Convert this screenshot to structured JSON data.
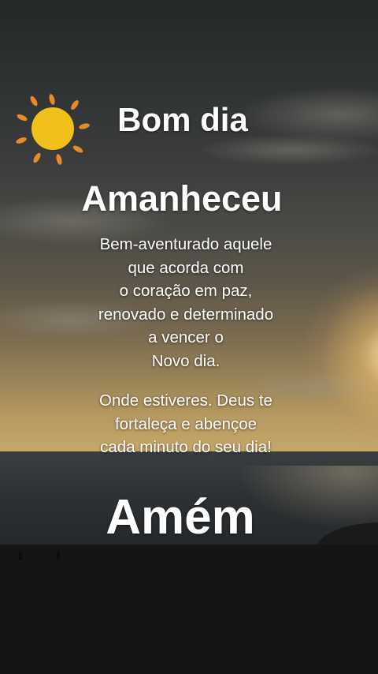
{
  "greeting": "Bom dia",
  "title": "Amanheceu",
  "verse_1": [
    "Bem-aventurado aquele",
    "que acorda com",
    "o coração em paz,",
    "renovado e determinado",
    "a vencer o",
    "Novo dia."
  ],
  "verse_2": [
    "Onde estiveres. Deus te",
    "fortaleça e abençoe",
    "cada minuto do seu dia!"
  ],
  "closing": "Amém",
  "colors": {
    "text": "#ffffff",
    "sun": "#f2c01a",
    "sun_rays": "#e8892a"
  },
  "icons": [
    "sun-icon"
  ]
}
